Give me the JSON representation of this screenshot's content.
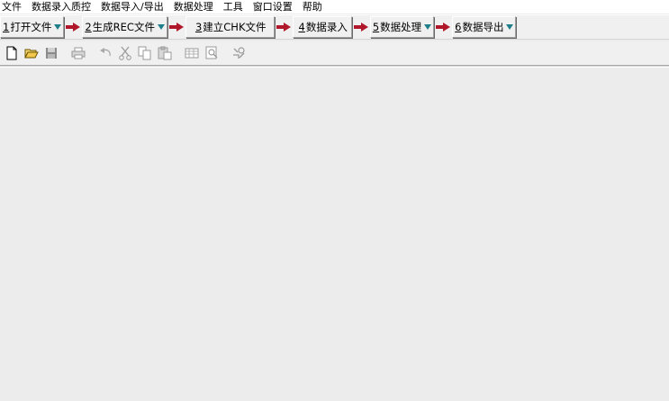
{
  "menu": [
    {
      "label": "文件"
    },
    {
      "label": "数据录入质控"
    },
    {
      "label": "数据导入/导出"
    },
    {
      "label": "数据处理"
    },
    {
      "label": "工具"
    },
    {
      "label": "窗口设置"
    },
    {
      "label": "帮助"
    }
  ],
  "workflow": {
    "steps": [
      {
        "num": "1",
        "label": "打开文件",
        "dropdown": true
      },
      {
        "num": "2",
        "label": "生成REC文件",
        "dropdown": true
      },
      {
        "num": "3",
        "label": "建立CHK文件",
        "dropdown": false
      },
      {
        "num": "4",
        "label": "数据录入",
        "dropdown": false
      },
      {
        "num": "5",
        "label": "数据处理",
        "dropdown": true
      },
      {
        "num": "6",
        "label": "数据导出",
        "dropdown": true
      }
    ],
    "arrow_color": "#b0172a",
    "dropdown_color": "#1e7f8a"
  },
  "toolbar": {
    "icons": [
      "new-file-icon",
      "open-folder-icon",
      "save-icon",
      "print-icon",
      "undo-icon",
      "cut-icon",
      "copy-icon",
      "paste-icon",
      "table-icon",
      "preview-icon",
      "settings-icon"
    ]
  }
}
